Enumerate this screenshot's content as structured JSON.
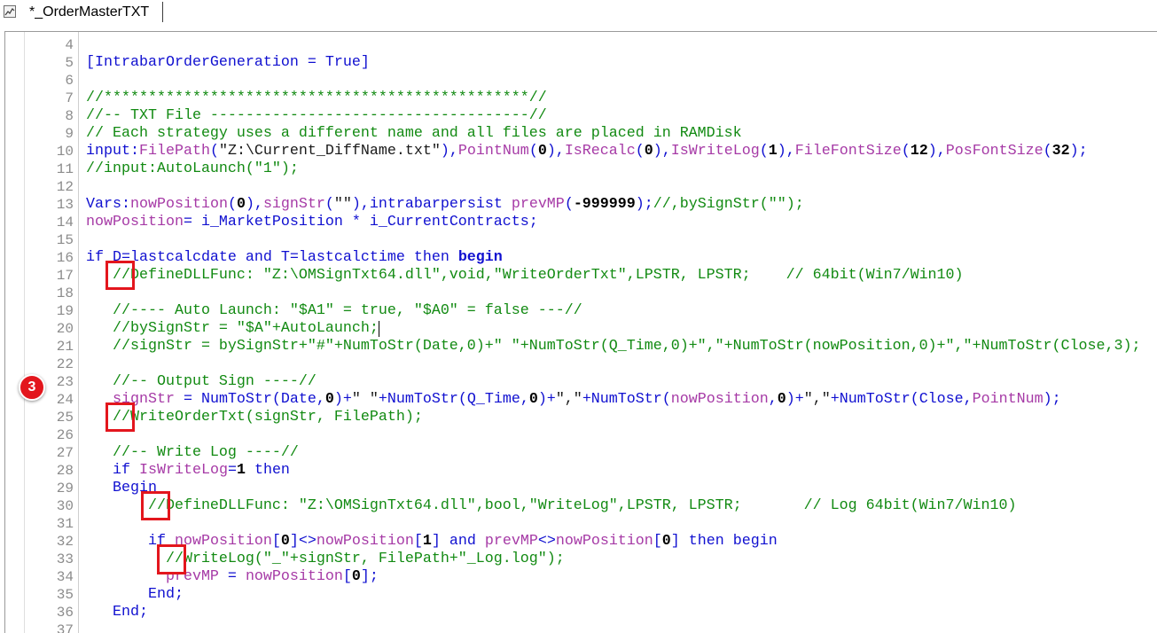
{
  "tab": {
    "title": "*_OrderMasterTXT",
    "icon": "chart-window-icon"
  },
  "annotations": {
    "step_badge": "3"
  },
  "colors": {
    "keyword": "#1010d0",
    "variable": "#a63aa6",
    "comment": "#128a12",
    "number": "#000000",
    "string": "#1a1a1a",
    "line_number": "#8c8c8c",
    "highlight": "#e3161d"
  },
  "editor": {
    "lines": [
      {
        "n": "4",
        "tokens": []
      },
      {
        "n": "5",
        "tokens": [
          {
            "kw": "[IntrabarOrderGeneration = True]"
          }
        ]
      },
      {
        "n": "6",
        "tokens": []
      },
      {
        "n": "7",
        "tokens": [
          {
            "cm": "//************************************************//"
          }
        ]
      },
      {
        "n": "8",
        "tokens": [
          {
            "cm": "//-- TXT File ------------------------------------//"
          }
        ]
      },
      {
        "n": "9",
        "tokens": [
          {
            "cm": "// Each strategy uses a different name and all files are placed in RAMDisk"
          }
        ]
      },
      {
        "n": "10",
        "tokens": [
          {
            "kw": "input:"
          },
          {
            "var": "FilePath"
          },
          {
            "kw": "("
          },
          {
            "str": "\"Z:\\Current_DiffName.txt\""
          },
          {
            "kw": "),"
          },
          {
            "var": "PointNum"
          },
          {
            "kw": "("
          },
          {
            "num": "0"
          },
          {
            "kw": "),"
          },
          {
            "var": "IsRecalc"
          },
          {
            "kw": "("
          },
          {
            "num": "0"
          },
          {
            "kw": "),"
          },
          {
            "var": "IsWriteLog"
          },
          {
            "kw": "("
          },
          {
            "num": "1"
          },
          {
            "kw": "),"
          },
          {
            "var": "FileFontSize"
          },
          {
            "kw": "("
          },
          {
            "num": "12"
          },
          {
            "kw": "),"
          },
          {
            "var": "PosFontSize"
          },
          {
            "kw": "("
          },
          {
            "num": "32"
          },
          {
            "kw": ");"
          }
        ]
      },
      {
        "n": "11",
        "tokens": [
          {
            "cm": "//input:AutoLaunch(\"1\");"
          }
        ]
      },
      {
        "n": "12",
        "tokens": []
      },
      {
        "n": "13",
        "tokens": [
          {
            "kw": "Vars:"
          },
          {
            "var": "nowPosition"
          },
          {
            "kw": "("
          },
          {
            "num": "0"
          },
          {
            "kw": "),"
          },
          {
            "var": "signStr"
          },
          {
            "kw": "("
          },
          {
            "str": "\"\""
          },
          {
            "kw": "),intrabarpersist "
          },
          {
            "var": "prevMP"
          },
          {
            "kw": "("
          },
          {
            "num": "-999999"
          },
          {
            "kw": ");"
          },
          {
            "cm": "//,bySignStr(\"\");"
          }
        ]
      },
      {
        "n": "14",
        "tokens": [
          {
            "var": "nowPosition"
          },
          {
            "kw": "= i_MarketPosition * i_CurrentContracts;"
          }
        ]
      },
      {
        "n": "15",
        "tokens": []
      },
      {
        "n": "16",
        "tokens": [
          {
            "kw": "if D=lastcalcdate and T=lastcalctime then "
          },
          {
            "kwb": "begin"
          }
        ]
      },
      {
        "n": "17",
        "tokens": [
          {
            "cm": "   //DefineDLLFunc: \"Z:\\OMSignTxt64.dll\",void,\"WriteOrderTxt\",LPSTR, LPSTR;    // 64bit(Win7/Win10)"
          }
        ]
      },
      {
        "n": "18",
        "tokens": []
      },
      {
        "n": "19",
        "tokens": [
          {
            "cm": "   //---- Auto Launch: \"$A1\" = true, \"$A0\" = false ---//"
          }
        ]
      },
      {
        "n": "20",
        "tokens": [
          {
            "cm": "   //bySignStr = \"$A\"+AutoLaunch;"
          }
        ]
      },
      {
        "n": "21",
        "tokens": [
          {
            "cm": "   //signStr = bySignStr+\"#\"+NumToStr(Date,0)+\" \"+NumToStr(Q_Time,0)+\",\"+NumToStr(nowPosition,0)+\",\"+NumToStr(Close,3);"
          }
        ]
      },
      {
        "n": "22",
        "tokens": []
      },
      {
        "n": "23",
        "tokens": [
          {
            "cm": "   //-- Output Sign ----//"
          }
        ]
      },
      {
        "n": "24",
        "tokens": [
          {
            "var": "   signStr"
          },
          {
            "kw": " = NumToStr(Date,"
          },
          {
            "num": "0"
          },
          {
            "kw": ")+"
          },
          {
            "str": "\" \""
          },
          {
            "kw": "+NumToStr(Q_Time,"
          },
          {
            "num": "0"
          },
          {
            "kw": ")+"
          },
          {
            "str": "\",\""
          },
          {
            "kw": "+NumToStr("
          },
          {
            "var": "nowPosition"
          },
          {
            "kw": ","
          },
          {
            "num": "0"
          },
          {
            "kw": ")+"
          },
          {
            "str": "\",\""
          },
          {
            "kw": "+NumToStr(Close,"
          },
          {
            "var": "PointNum"
          },
          {
            "kw": ");"
          }
        ]
      },
      {
        "n": "25",
        "tokens": [
          {
            "cm": "   //WriteOrderTxt(signStr, FilePath);"
          }
        ]
      },
      {
        "n": "26",
        "tokens": []
      },
      {
        "n": "27",
        "tokens": [
          {
            "cm": "   //-- Write Log ----//"
          }
        ]
      },
      {
        "n": "28",
        "tokens": [
          {
            "kw": "   if "
          },
          {
            "var": "IsWriteLog"
          },
          {
            "kw": "="
          },
          {
            "num": "1"
          },
          {
            "kw": " then"
          }
        ]
      },
      {
        "n": "29",
        "tokens": [
          {
            "kw": "   Begin"
          }
        ]
      },
      {
        "n": "30",
        "tokens": [
          {
            "cm": "       //DefineDLLFunc: \"Z:\\OMSignTxt64.dll\",bool,\"WriteLog\",LPSTR, LPSTR;       // Log 64bit(Win7/Win10)"
          }
        ]
      },
      {
        "n": "31",
        "tokens": []
      },
      {
        "n": "32",
        "tokens": [
          {
            "kw": "       if "
          },
          {
            "var": "nowPosition"
          },
          {
            "kw": "["
          },
          {
            "num": "0"
          },
          {
            "kw": "]<>"
          },
          {
            "var": "nowPosition"
          },
          {
            "kw": "["
          },
          {
            "num": "1"
          },
          {
            "kw": "] and "
          },
          {
            "var": "prevMP"
          },
          {
            "kw": "<>"
          },
          {
            "var": "nowPosition"
          },
          {
            "kw": "["
          },
          {
            "num": "0"
          },
          {
            "kw": "] then begin"
          }
        ]
      },
      {
        "n": "33",
        "tokens": [
          {
            "cm": "         //WriteLog(\"_\"+signStr, FilePath+\"_Log.log\");"
          }
        ]
      },
      {
        "n": "34",
        "tokens": [
          {
            "var": "         prevMP"
          },
          {
            "kw": " = "
          },
          {
            "var": "nowPosition"
          },
          {
            "kw": "["
          },
          {
            "num": "0"
          },
          {
            "kw": "];"
          }
        ]
      },
      {
        "n": "35",
        "tokens": [
          {
            "kw": "       End;"
          }
        ]
      },
      {
        "n": "36",
        "tokens": [
          {
            "kw": "   End;"
          }
        ]
      },
      {
        "n": "37",
        "tokens": []
      }
    ]
  }
}
